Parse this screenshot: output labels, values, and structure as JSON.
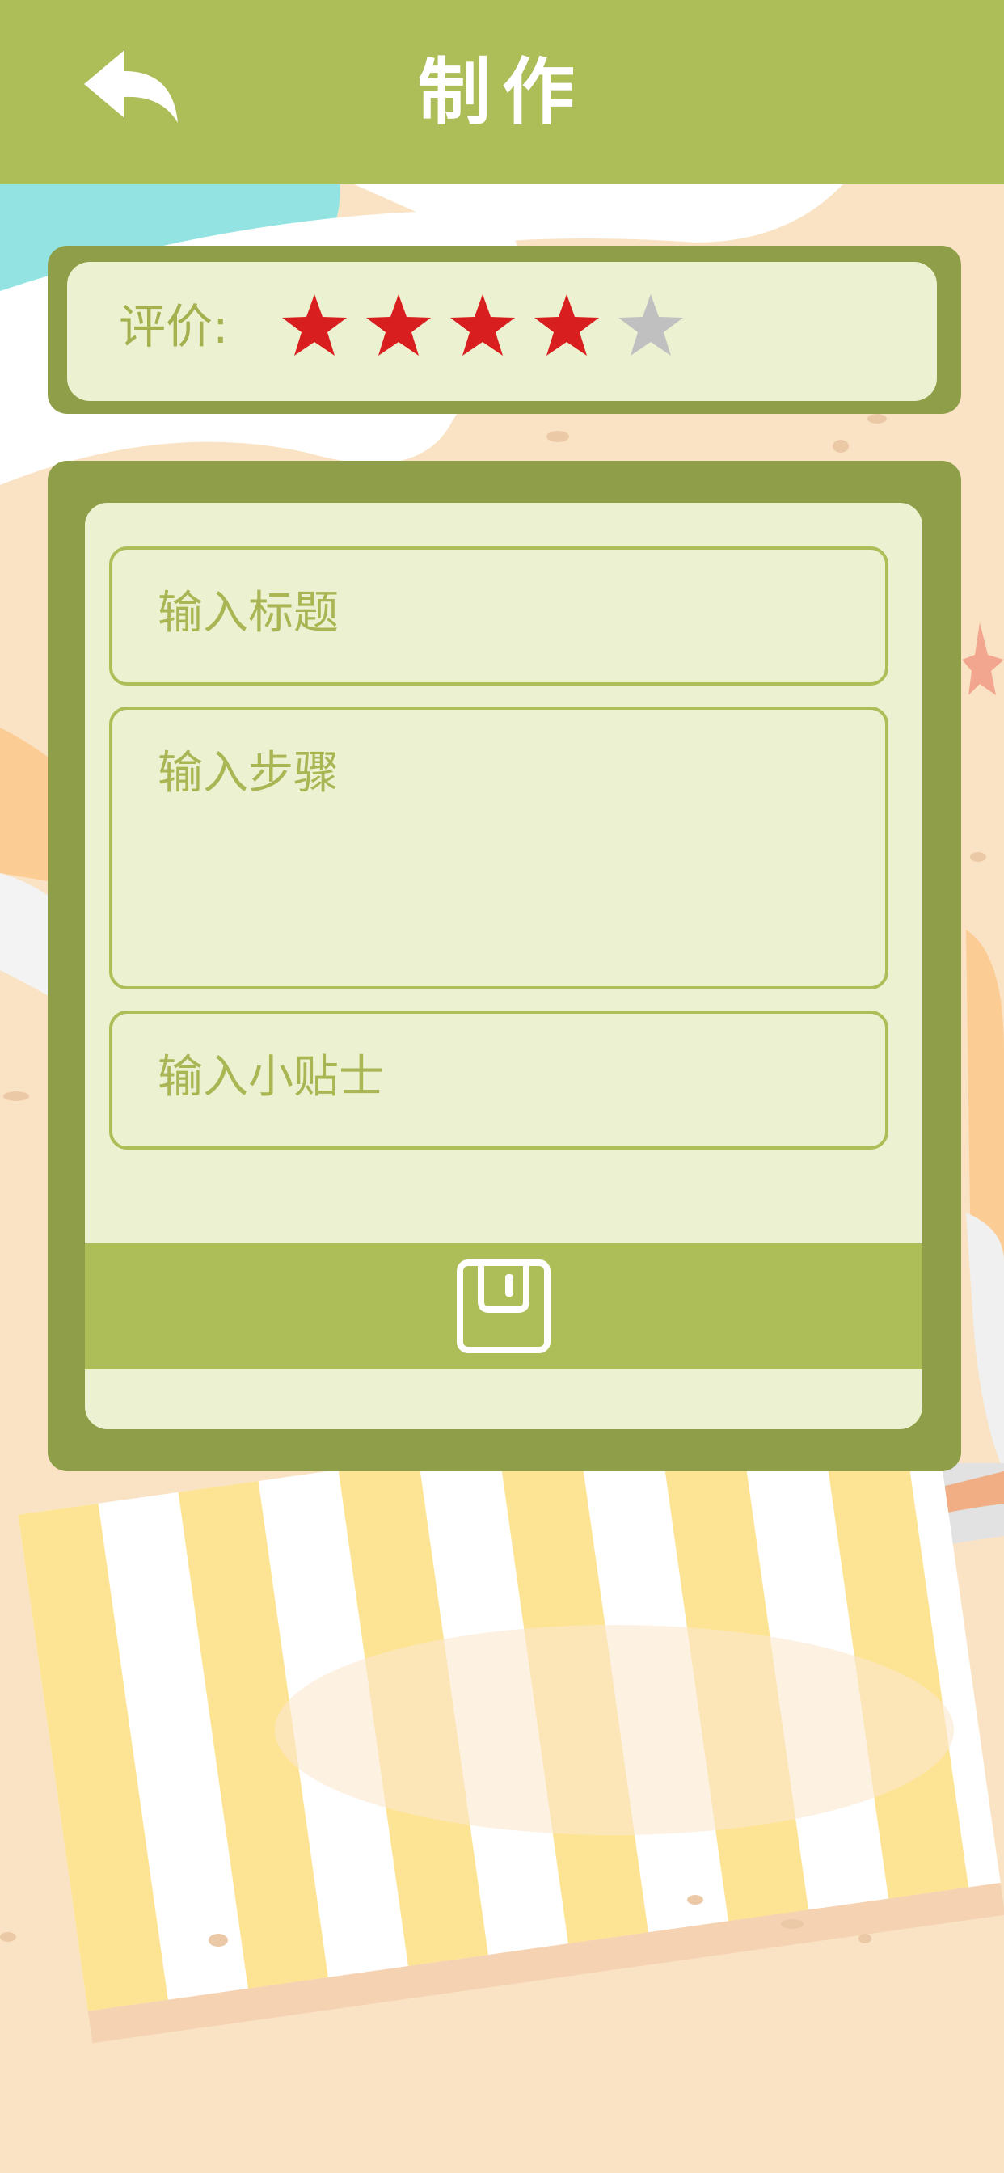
{
  "header": {
    "title": "制作",
    "back_icon": "back-arrow-icon"
  },
  "rating": {
    "label": "评价:",
    "value": 4,
    "max": 5,
    "filled_color": "#d81e1e",
    "empty_color": "#c0c0c0"
  },
  "form": {
    "title_field": {
      "placeholder": "输入标题",
      "value": ""
    },
    "steps_field": {
      "placeholder": "输入步骤",
      "value": ""
    },
    "tips_field": {
      "placeholder": "输入小贴士",
      "value": ""
    },
    "save_icon": "floppy-disk-icon"
  },
  "colors": {
    "accent": "#adbe58",
    "card_dark": "#8f9e48",
    "card_light": "#ecf2d1",
    "background": "#fae3c4"
  }
}
